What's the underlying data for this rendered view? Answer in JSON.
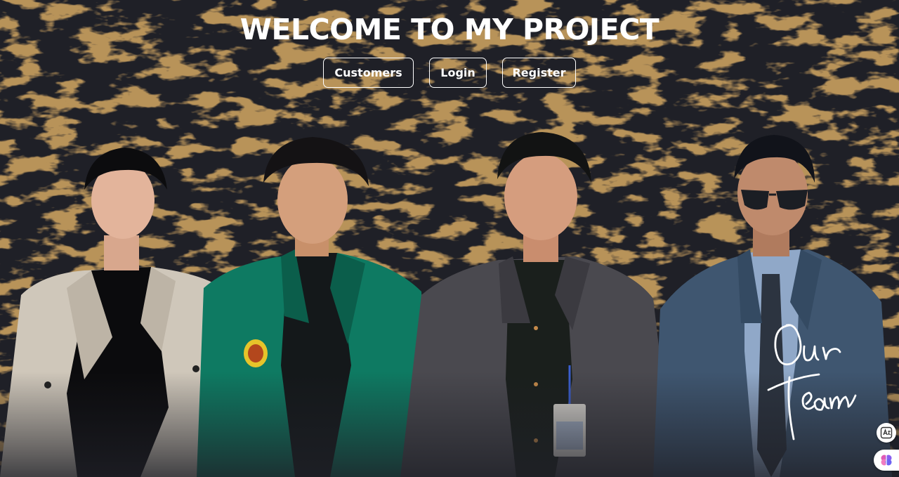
{
  "header": {
    "title": "WELCOME TO MY PROJECT"
  },
  "nav": {
    "customers_label": "Customers",
    "login_label": "Login",
    "register_label": "Register"
  },
  "hero": {
    "signature_text": "Our Team",
    "members": [
      {
        "attire": "beige blazer, black shirt"
      },
      {
        "attire": "green jacket with emblem, black shirt"
      },
      {
        "attire": "grey blazer, dark shirt, ID badge"
      },
      {
        "attire": "blue-grey suit, tie, sunglasses"
      }
    ]
  },
  "floating_tools": [
    {
      "icon": "translate-icon"
    },
    {
      "icon": "brain-icon"
    }
  ],
  "colors": {
    "background": "#1f2027",
    "texture": "#7a4a1a",
    "text": "#ffffff",
    "button_border": "#ffffff"
  }
}
